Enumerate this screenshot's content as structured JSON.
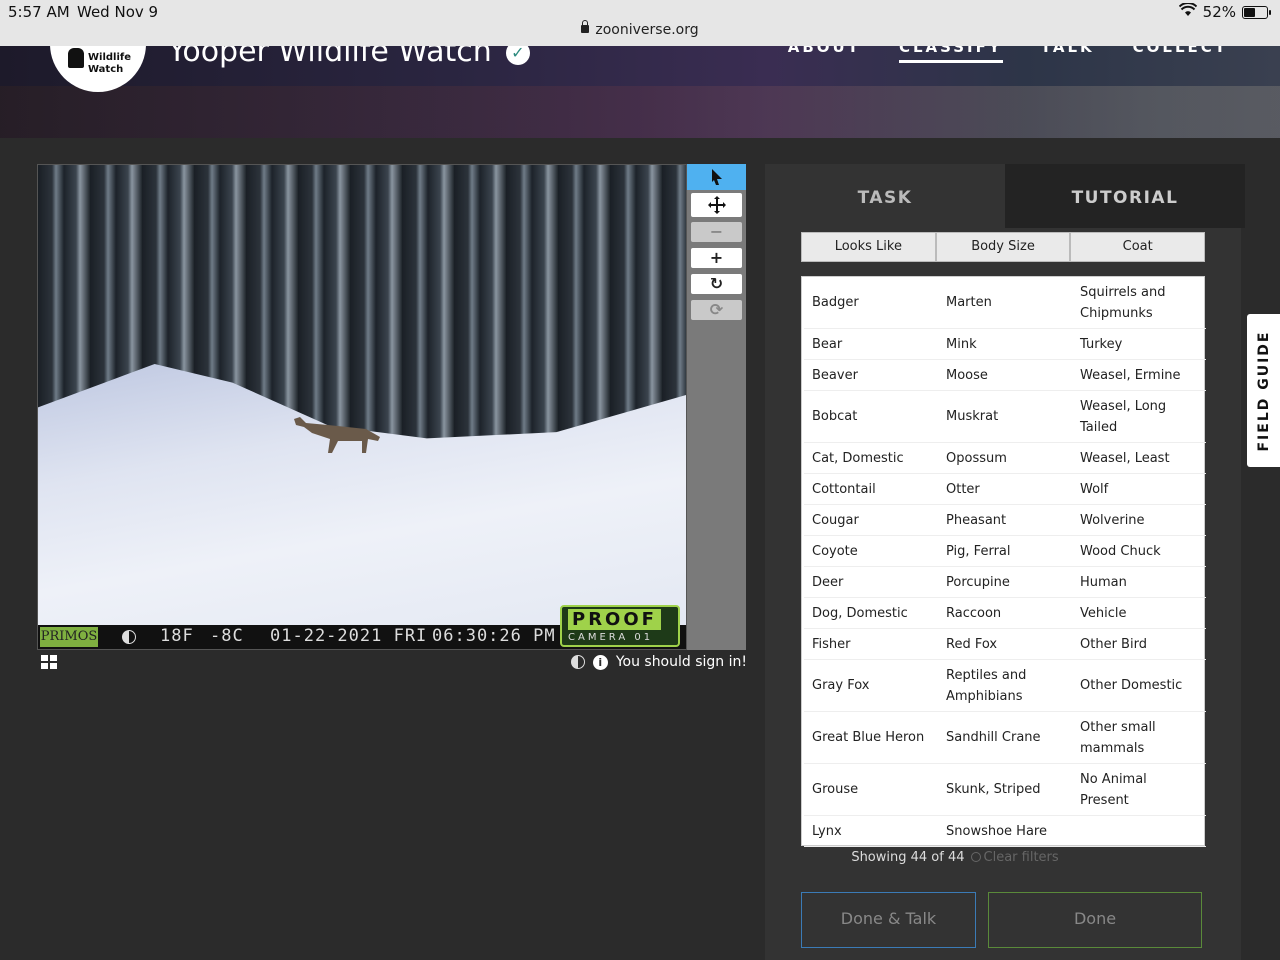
{
  "status_bar": {
    "time": "5:57 AM",
    "date": "Wed Nov 9",
    "battery": "52%",
    "battery_level": 0.52,
    "url": "zooniverse.org"
  },
  "header": {
    "logo_text_line1": "Wildlife",
    "logo_text_line2": "Watch",
    "project_title": "Yooper Wildlife Watch",
    "nav": {
      "about": "ABOUT",
      "classify": "CLASSIFY",
      "talk": "TALK",
      "collect": "COLLECT"
    }
  },
  "image_overlay": {
    "brand_left": "PRIMOS",
    "temp_f": "18F",
    "temp_c": "-8C",
    "date": "01-22-2021 FRI",
    "time": "06:30:26 PM",
    "brand_right_top": "PROOF",
    "brand_right_bottom": "CAMERA 01"
  },
  "toolbar": {
    "pointer_icon": "pointer-icon",
    "move_icon": "move-icon",
    "zoom_out": "−",
    "zoom_in": "+",
    "rotate": "↻",
    "reset": "⟳"
  },
  "viewer_footer": {
    "sign_in": "You should sign in!"
  },
  "panel": {
    "tab_task": "TASK",
    "tab_tutorial": "TUTORIAL",
    "filters": [
      "Looks Like",
      "Body Size",
      "Coat"
    ],
    "choices": [
      "Badger",
      "Marten",
      "Squirrels and Chipmunks",
      "Bear",
      "Mink",
      "Turkey",
      "Beaver",
      "Moose",
      "Weasel, Ermine",
      "Bobcat",
      "Muskrat",
      "Weasel, Long Tailed",
      "Cat, Domestic",
      "Opossum",
      "Weasel, Least",
      "Cottontail",
      "Otter",
      "Wolf",
      "Cougar",
      "Pheasant",
      "Wolverine",
      "Coyote",
      "Pig, Ferral",
      "Wood Chuck",
      "Deer",
      "Porcupine",
      "Human",
      "Dog, Domestic",
      "Raccoon",
      "Vehicle",
      "Fisher",
      "Red Fox",
      "Other Bird",
      "Gray Fox",
      "Reptiles and Amphibians",
      "Other Domestic",
      "Great Blue Heron",
      "Sandhill Crane",
      "Other small mammals",
      "Grouse",
      "Skunk, Striped",
      "No Animal Present",
      "Lynx",
      "Snowshoe Hare",
      ""
    ],
    "showing": "Showing 44 of 44",
    "clear_filters": "Clear filters",
    "done_talk": "Done & Talk",
    "done": "Done"
  },
  "field_guide": "FIELD GUIDE",
  "colors": {
    "accent_blue": "#4fb1f0",
    "done_green": "#5a8a3a",
    "talk_blue": "#3b7bb6",
    "panel_bg": "#333333"
  }
}
